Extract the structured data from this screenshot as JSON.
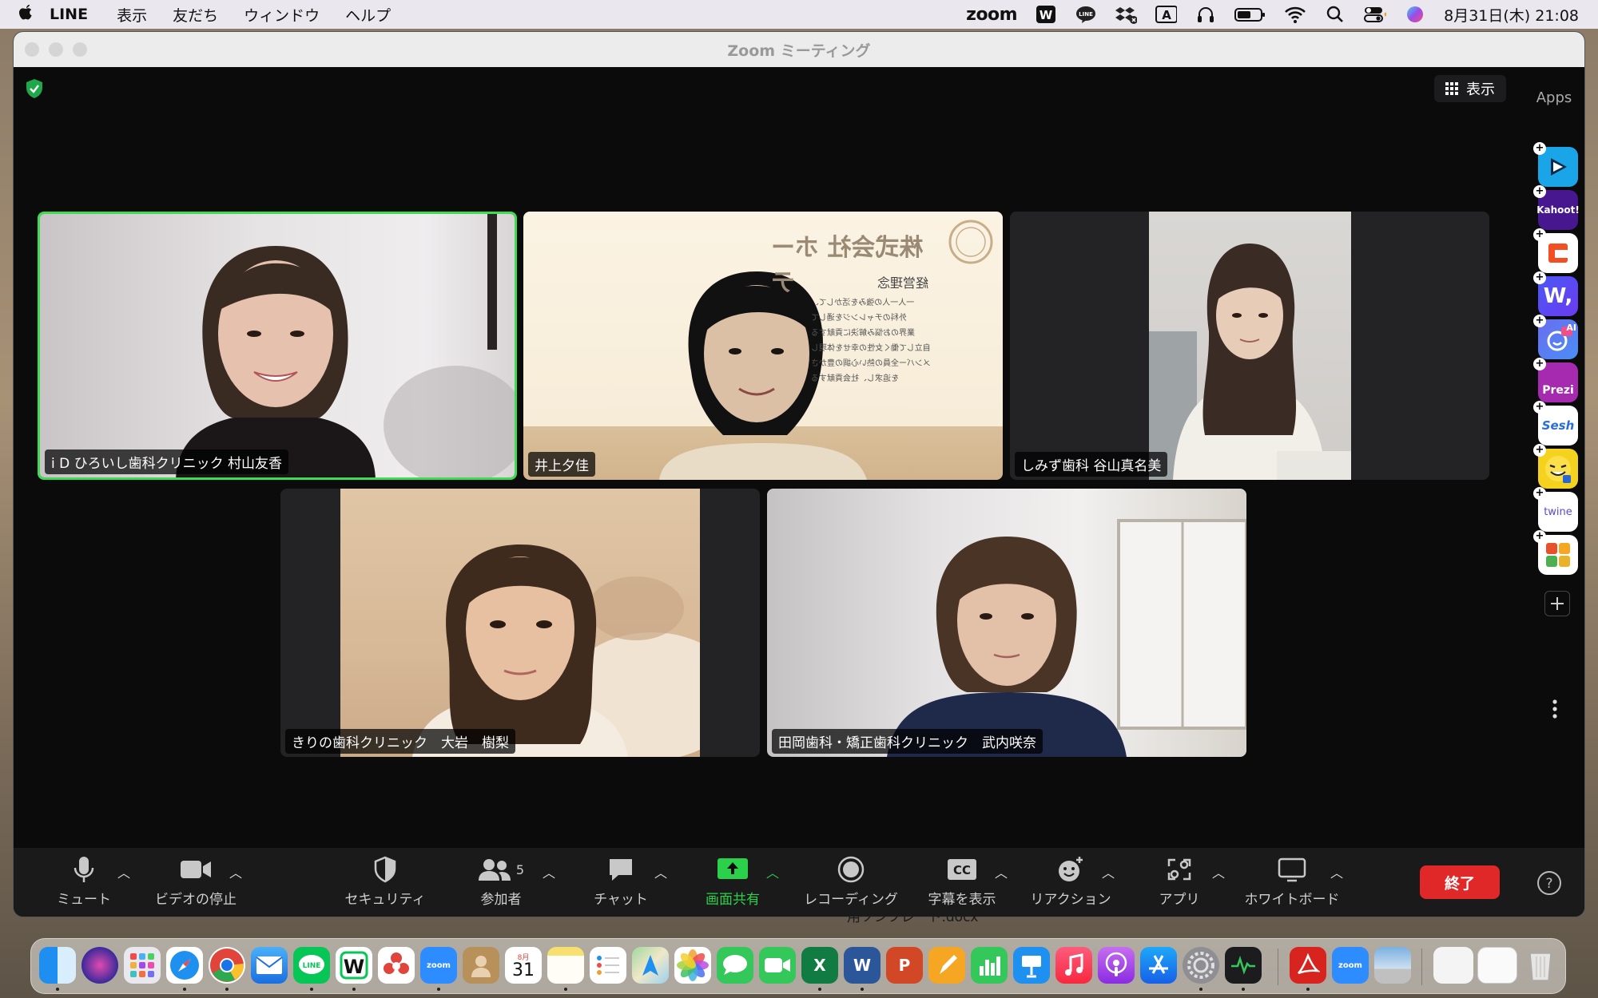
{
  "menubar": {
    "app_name": "LINE",
    "menus": [
      "表示",
      "友だち",
      "ウィンドウ",
      "ヘルプ"
    ],
    "zoom_label": "zoom",
    "input_label": "A",
    "datetime": "8月31日(木)  21:08"
  },
  "window": {
    "title": "Zoom ミーティング",
    "view_label": "表示"
  },
  "participants": [
    {
      "name": "i D ひろいし歯科クリニック 村山友香",
      "active": true
    },
    {
      "name": "井上夕佳",
      "active": false
    },
    {
      "name": "しみず歯科 谷山真名美",
      "active": false
    },
    {
      "name": "きりの歯科クリニック　大岩　樹梨",
      "active": false
    },
    {
      "name": "田岡歯科・矯正歯科クリニック　武内咲奈",
      "active": false
    }
  ],
  "background": {
    "company": "株式会社 ホーテ",
    "heading": "経営理念",
    "lines": [
      "一人一人の強みを活かして、",
      "外科のチャレンジを通して",
      "業界のお悩み解決に貢献する",
      "自立して働く女性の幸せを体現し",
      "メンバー全員の熱い心調の豊かさ",
      "を追求し、社会貢献する"
    ]
  },
  "apps": {
    "title": "Apps",
    "items": [
      {
        "id": "app-1",
        "label": "",
        "color": "#1aa5e8"
      },
      {
        "id": "kahoot",
        "label": "Kahoot!",
        "color": "#46178f"
      },
      {
        "id": "app-3",
        "label": "",
        "color": "#ffffff"
      },
      {
        "id": "app-w",
        "label": "W,",
        "color": "#3b5bf5"
      },
      {
        "id": "app-ai",
        "label": "AI",
        "color": "#5c6cf5"
      },
      {
        "id": "prezi",
        "label": "Prezi",
        "color": "#a62ab0"
      },
      {
        "id": "sesh",
        "label": "Sesh",
        "color": "#ffffff"
      },
      {
        "id": "app-emoji",
        "label": "",
        "color": "#f5d21e"
      },
      {
        "id": "twine",
        "label": "twine",
        "color": "#ffffff"
      },
      {
        "id": "app-blocks",
        "label": "",
        "color": "#ffffff"
      }
    ]
  },
  "toolbar": {
    "mute": "ミュート",
    "video": "ビデオの停止",
    "security": "セキュリティ",
    "participants": "参加者",
    "participant_count": "5",
    "chat": "チャット",
    "share": "画面共有",
    "record": "レコーディング",
    "captions": "字幕を表示",
    "cc": "CC",
    "reactions": "リアクション",
    "apps": "アプリ",
    "whiteboard": "ホワイトボード",
    "end": "終了"
  },
  "desktop": {
    "doc_label": "用ソンフレート.docx",
    "calendar_day": "31",
    "calendar_month": "8月"
  },
  "colors": {
    "active_border": "#3ddc52",
    "share_green": "#2bd04b",
    "end_red": "#e02828"
  }
}
